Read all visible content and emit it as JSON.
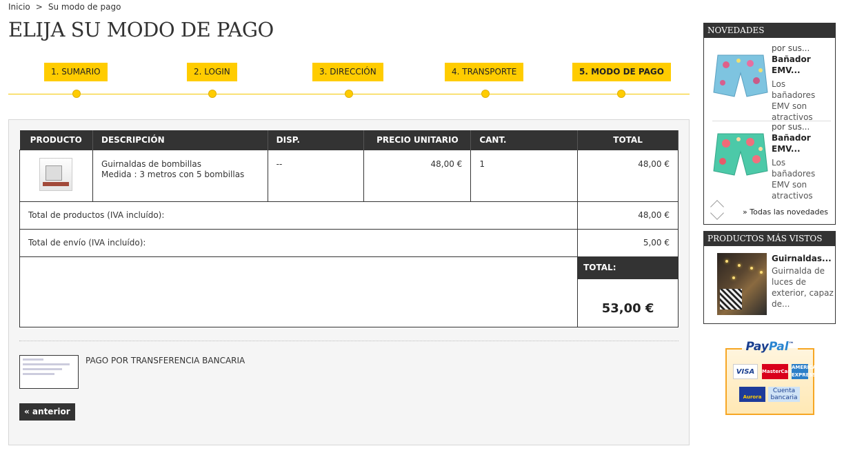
{
  "breadcrumb": {
    "home": "Inicio",
    "separator": ">",
    "current": "Su modo de pago"
  },
  "page_title": "ELIJA SU MODO DE PAGO",
  "steps": [
    {
      "label": "1. SUMARIO",
      "active": false
    },
    {
      "label": "2. LOGIN",
      "active": false
    },
    {
      "label": "3. DIRECCIÓN",
      "active": false
    },
    {
      "label": "4. TRANSPORTE",
      "active": false
    },
    {
      "label": "5. MODO DE PAGO",
      "active": true
    }
  ],
  "cart": {
    "headers": [
      "PRODUCTO",
      "DESCRIPCIÓN",
      "DISP.",
      "PRECIO UNITARIO",
      "CANT.",
      "TOTAL"
    ],
    "rows": [
      {
        "name": "Guirnaldas de bombillas",
        "attributes": "Medida : 3 metros con 5 bombillas",
        "availability": "--",
        "unit_price": "48,00 €",
        "quantity": "1",
        "total": "48,00 €"
      }
    ],
    "total_products_label": "Total de productos (IVA incluído):",
    "total_products_value": "48,00 €",
    "total_shipping_label": "Total de envío (IVA incluído):",
    "total_shipping_value": "5,00 €",
    "grand_total_label": "TOTAL:",
    "grand_total_value": "53,00 €"
  },
  "payment": {
    "method_label": "PAGO POR TRANSFERENCIA BANCARIA"
  },
  "back_button": "« anterior",
  "sidebar": {
    "novedades": {
      "title": "NOVEDADES",
      "items": [
        {
          "cut": "por sus...",
          "title": "Bañador EMV...",
          "desc": "Los bañadores EMV son atractivos"
        },
        {
          "cut": "por sus...",
          "title": "Bañador EMV...",
          "desc": "Los bañadores EMV son atractivos"
        }
      ],
      "all_link": "» Todas las novedades"
    },
    "mas_vistos": {
      "title": "PRODUCTOS MÁS VISTOS",
      "item": {
        "title": "Guirnaldas...",
        "desc": "Guirnalda de luces de exterior, capaz de..."
      }
    },
    "paypal": {
      "title_a": "Pay",
      "title_b": "Pal",
      "trademark": "™",
      "cards": {
        "visa": "VISA",
        "mastercard": "MasterCard",
        "amex": "AMERICAN EXPRESS",
        "aurora": "Aurora",
        "cuenta": "Cuenta bancaria"
      }
    }
  },
  "colors": {
    "accent": "#ffcc00",
    "dark": "#333333",
    "paypal_orange": "#f6a623"
  }
}
